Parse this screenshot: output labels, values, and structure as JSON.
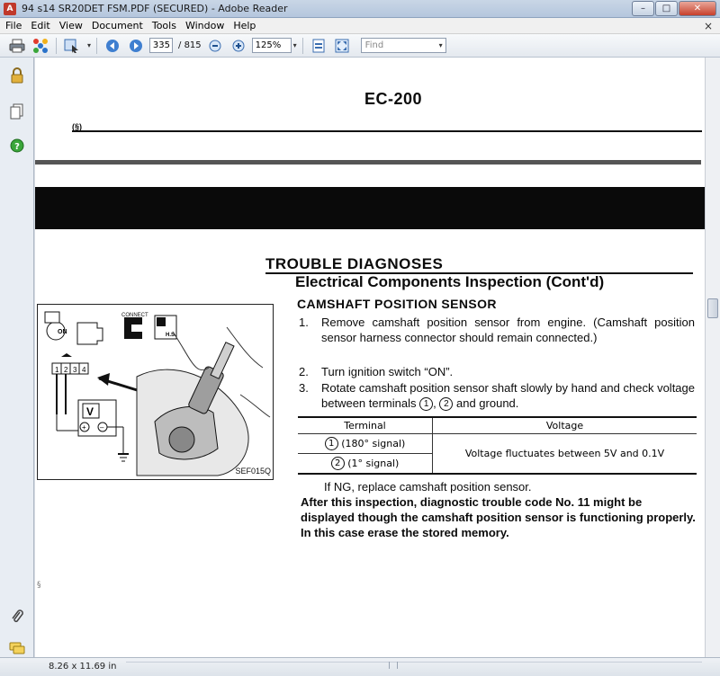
{
  "window": {
    "title": "94 s14 SR20DET  FSM.PDF (SECURED) - Adobe Reader",
    "app_icon": "A",
    "minimize": "–",
    "maximize": "□",
    "close": "✕"
  },
  "menu": {
    "items": [
      {
        "label": "File"
      },
      {
        "label": "Edit"
      },
      {
        "label": "View"
      },
      {
        "label": "Document"
      },
      {
        "label": "Tools"
      },
      {
        "label": "Window"
      },
      {
        "label": "Help"
      }
    ],
    "close_doc": "×"
  },
  "toolbar": {
    "current_page": "335",
    "page_total": "/ 815",
    "zoom": "125%",
    "find_placeholder": "Find",
    "dropdown_arrow": "▾"
  },
  "statusbar": {
    "page_size": "8.26 x 11.69 in"
  },
  "page": {
    "page_number": "EC-200",
    "mark": "(§)",
    "section_title": "TROUBLE DIAGNOSES",
    "subtitle": "Electrical Components Inspection (Cont'd)",
    "heading": "CAMSHAFT POSITION SENSOR",
    "steps": [
      {
        "num": "1.",
        "text": "Remove camshaft position sensor from engine. (Camshaft position sensor harness connector should remain connected.)"
      },
      {
        "num": "2.",
        "text": "Turn ignition switch “ON”."
      },
      {
        "num": "3.",
        "text_a": "Rotate camshaft position sensor shaft slowly by hand and check voltage between terminals",
        "t1": "1",
        "sep": ",",
        "t2": "2",
        "text_b": "and ground."
      }
    ],
    "table": {
      "col_terminal": "Terminal",
      "col_voltage": "Voltage",
      "row1_circle": "1",
      "row1_label": "(180° signal)",
      "row2_circle": "2",
      "row2_label": "(1° signal)",
      "voltage_text": "Voltage fluctuates between 5V and 0.1V"
    },
    "ng_text": "If NG, replace camshaft position sensor.",
    "note": "After this inspection, diagnostic trouble code No. 11 might be displayed though the camshaft position sensor is functioning properly. In this case erase the stored memory.",
    "figure": {
      "label": "SEF015Q",
      "connect_label": "CONNECT",
      "hs_label": "H.S.",
      "on_label": "ON",
      "volt_label": "V",
      "plus": "+",
      "minus": "–",
      "terminals": [
        "1",
        "2",
        "3",
        "4"
      ]
    },
    "tiny_mark": "§"
  },
  "colors": {
    "titlebar": "#b4c6dd",
    "pdf_red": "#c0392b",
    "nav_bg": "#e8edf3"
  }
}
